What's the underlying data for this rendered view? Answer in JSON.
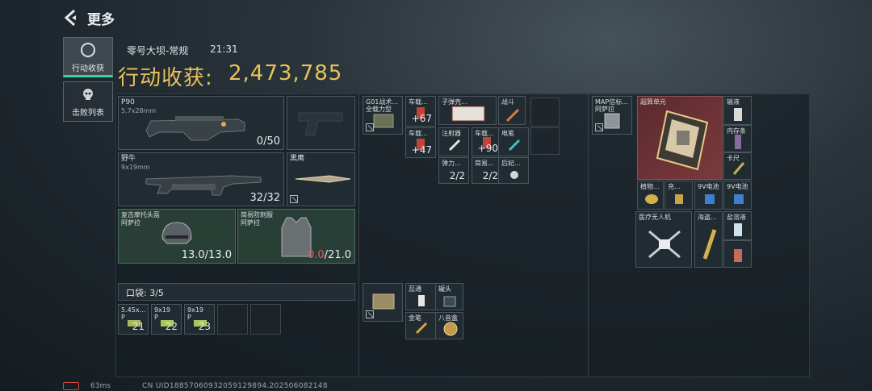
{
  "header": {
    "back_label": "更多"
  },
  "tabs": [
    {
      "label": "行动收获",
      "icon": "loot-icon"
    },
    {
      "label": "击败列表",
      "icon": "skull-icon"
    }
  ],
  "session": {
    "map": "零号大坝-常规",
    "time": "21:31"
  },
  "loot": {
    "title": "行动收获:",
    "value": "2,473,785"
  },
  "equipment": {
    "primary": {
      "name": "P90",
      "caliber": "5.7x28mm",
      "ammo": "0/50"
    },
    "sidearm_slot": {
      "name": ""
    },
    "secondary": {
      "name": "野牛",
      "caliber": "9x19mm",
      "ammo": "32/32"
    },
    "melee": {
      "name": "黑鹰"
    },
    "helmet": {
      "name": "复古摩托头盔",
      "sub": "阿萨拉",
      "durability": "13.0/13.0"
    },
    "armor": {
      "name": "简易防刺服",
      "sub": "阿萨拉",
      "durability_current": "0.0",
      "durability_max": "/21.0"
    }
  },
  "pocket": {
    "label": "口袋: 3/5",
    "items": [
      {
        "name": "5.45x...\nP",
        "count": "21"
      },
      {
        "name": "9x19\nP",
        "count": "22"
      },
      {
        "name": "9x19\nP",
        "count": "23"
      }
    ]
  },
  "rig": {
    "items": [
      {
        "name": "G01战术...\n全载力型"
      },
      {
        "name": "车载...",
        "count": "+67"
      },
      {
        "name": "车载...",
        "count": "+47"
      },
      {
        "name": "子弹壳..."
      },
      {
        "name": "战斗"
      },
      {
        "name": "注射器"
      },
      {
        "name": "车载...",
        "count": "+90"
      },
      {
        "name": "电笔"
      },
      {
        "name": "弹力...",
        "count": "2/2"
      },
      {
        "name": "简易...",
        "count": "2/2"
      },
      {
        "name": "后妃..."
      }
    ]
  },
  "pack": {
    "items": [
      {
        "name": ""
      },
      {
        "name": "蕊通"
      },
      {
        "name": "罐头"
      },
      {
        "name": "金笔"
      },
      {
        "name": "八音盒"
      }
    ]
  },
  "backpack": {
    "items": [
      {
        "name": "MAP信标...\n阿萨拉"
      },
      {
        "name": "超算单元"
      },
      {
        "name": "输液"
      },
      {
        "name": "内存条"
      },
      {
        "name": "卡尺"
      },
      {
        "name": "植物..."
      },
      {
        "name": "充..."
      },
      {
        "name": "9V电池"
      },
      {
        "name": "9V电池"
      },
      {
        "name": "医疗无人机"
      },
      {
        "name": "海盗..."
      },
      {
        "name": "盐溶液"
      }
    ]
  },
  "footer": {
    "ping": "63ms",
    "uid": "CN UID18857060932059129894.20250608214​8"
  },
  "colors": {
    "accent": "#36d5a2",
    "gold": "#e9c35a",
    "warning": "#e15a57"
  }
}
